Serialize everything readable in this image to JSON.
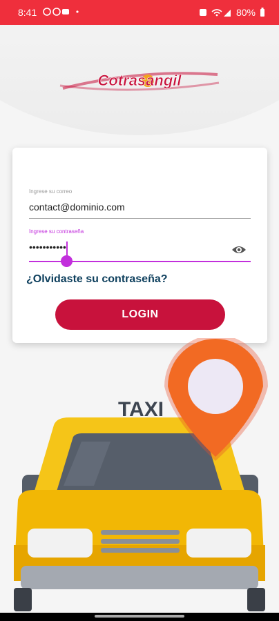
{
  "status_bar": {
    "time": "8:41",
    "battery": "80%"
  },
  "app": {
    "logo_text": "Cotrasangil"
  },
  "login_form": {
    "email_label": "Ingrese su correo",
    "email_value": "contact@dominio.com",
    "password_label": "Ingrese su contraseña",
    "password_value": "•••••••••••",
    "forgot_link": "¿Olvidaste su contraseña?",
    "login_button": "LOGIN"
  },
  "illustration": {
    "sign_text": "TAXI"
  },
  "colors": {
    "status_bar": "#ef2f3c",
    "accent": "#c22fdc",
    "primary_button": "#c8123c",
    "link": "#0c3e5c"
  }
}
